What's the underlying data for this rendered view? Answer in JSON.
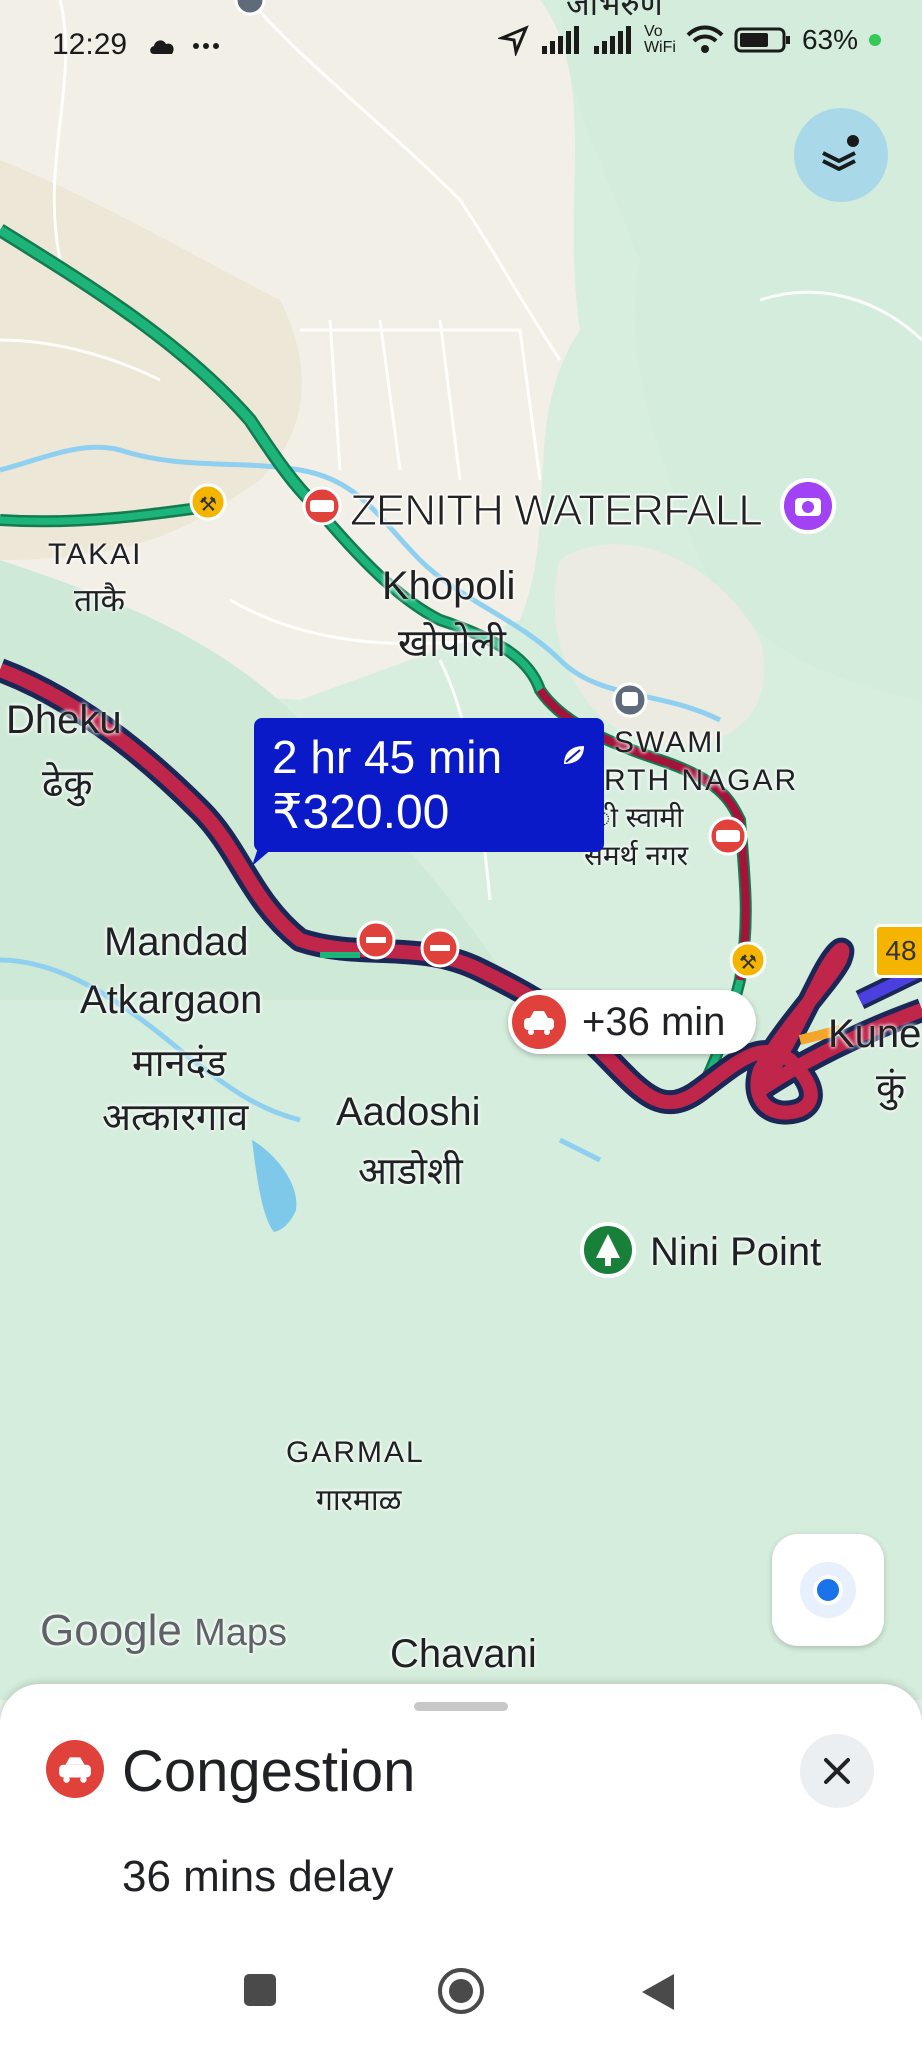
{
  "status": {
    "time": "12:29",
    "battery": "63%",
    "network_label": "Vo WiFi"
  },
  "map": {
    "labels": {
      "takai": "TAKAI",
      "takai_hi": "ताकै",
      "zenith": "ZENITH WATERFALL",
      "khopoli": "Khopoli",
      "khopoli_hi": "खोपोली",
      "dheku": "Dheku",
      "dheku_hi": "ढेकु",
      "swami_1": "SWAMI",
      "swami_2": "RTH NAGAR",
      "swami_hi_1": "ी स्वामी",
      "swami_hi_2": "समर्थ नगर",
      "mandad_1": "Mandad",
      "mandad_2": "Atkargaon",
      "mandad_hi_1": "मानदंड",
      "mandad_hi_2": "अत्कारगाव",
      "aadoshi": "Aadoshi",
      "aadoshi_hi": "आडोशी",
      "nini": "Nini Point",
      "kune": "Kune",
      "kune_hi": "कुं",
      "garmal": "GARMAL",
      "garmal_hi": "गारमाळ",
      "chavani": "Chavani",
      "top_hi": "जाभरुण"
    },
    "highway_number": "48",
    "route_callout": {
      "duration": "2 hr 45 min",
      "toll": "₹320.00"
    },
    "delay_pill": "+36 min",
    "watermark_google": "Google",
    "watermark_maps": "Maps",
    "colors": {
      "route_slow": "#c0254a",
      "route_outline": "#1a2757",
      "route_fast": "#1db47a",
      "incident": "#e0413a",
      "callout_bg": "#0a1ac9"
    }
  },
  "sheet": {
    "title": "Congestion",
    "subtitle": "36 mins delay"
  },
  "icons": {
    "layers": "layers-icon",
    "location": "my-location-icon",
    "close": "close-icon",
    "congestion": "congestion-car-icon"
  }
}
